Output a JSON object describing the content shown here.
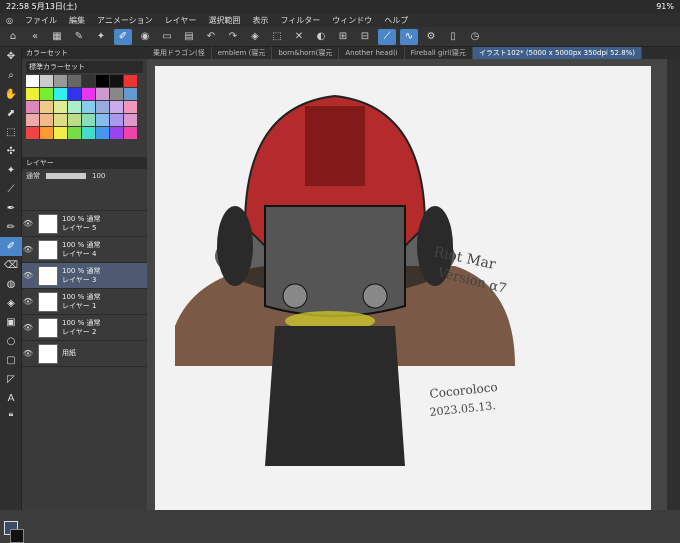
{
  "status": {
    "time": "22:58",
    "date": "5月13日(土)",
    "battery": "91%"
  },
  "menu": [
    "ファイル",
    "編集",
    "アニメーション",
    "レイヤー",
    "選択範囲",
    "表示",
    "フィルター",
    "ウィンドウ",
    "ヘルプ"
  ],
  "tabs": [
    "乗用ドラゴン(怪",
    "emblem (寝元",
    "born&horn(寝元",
    "Another head(i",
    "Fireball girl(寝元",
    "イラスト102* (5000 x 5000px 350dpi 52.8%)"
  ],
  "palette": {
    "tab": "カラーセット",
    "select": "標準カラーセット"
  },
  "layerpanel": {
    "tab": "レイヤー",
    "blend": "通常",
    "opacity": "100"
  },
  "layers": [
    {
      "pct": "100 % 通常",
      "name": "レイヤー 5"
    },
    {
      "pct": "100 % 通常",
      "name": "レイヤー 4"
    },
    {
      "pct": "100 % 通常",
      "name": "レイヤー 3"
    },
    {
      "pct": "100 % 通常",
      "name": "レイヤー 1"
    },
    {
      "pct": "100 % 通常",
      "name": "レイヤー 2"
    },
    {
      "pct": "",
      "name": "用紙"
    }
  ],
  "art": {
    "sig1": "Riot Mar",
    "sig2": "Version α7",
    "sig3": "Cocoroloco",
    "sig4": "2023.05.13."
  }
}
